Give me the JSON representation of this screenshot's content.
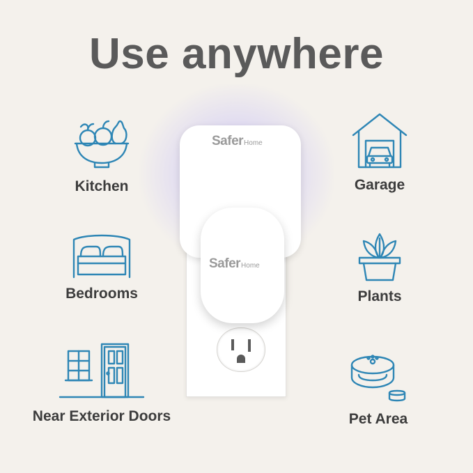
{
  "headline": "Use anywhere",
  "features": [
    {
      "label": "Kitchen",
      "icon": "fruit-bowl-icon"
    },
    {
      "label": "Garage",
      "icon": "garage-icon"
    },
    {
      "label": "Bedrooms",
      "icon": "bed-icon"
    },
    {
      "label": "Plants",
      "icon": "potted-plant-icon"
    },
    {
      "label": "Near Exterior Doors",
      "icon": "door-window-icon"
    },
    {
      "label": "Pet Area",
      "icon": "pet-bed-icon"
    }
  ],
  "product": {
    "brand": "Safer",
    "brand_sub": "Home"
  },
  "colors": {
    "icon_stroke": "#2e86b5",
    "headline": "#5a5a5a",
    "label": "#3c3c3c",
    "background": "#f4f1ec",
    "glow": "#9a8cff"
  }
}
